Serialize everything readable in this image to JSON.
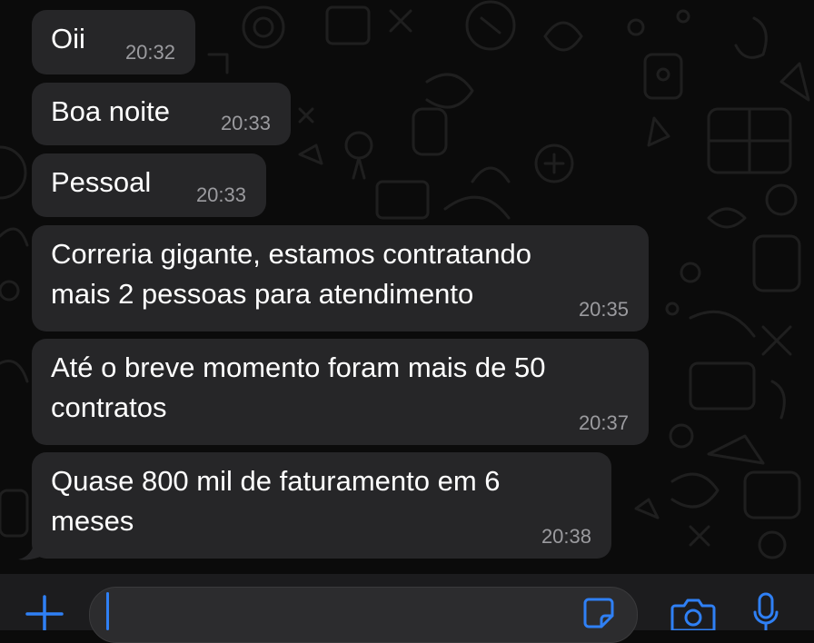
{
  "messages": [
    {
      "text": "Oii",
      "time": "20:32"
    },
    {
      "text": "Boa noite",
      "time": "20:33"
    },
    {
      "text": "Pessoal",
      "time": "20:33"
    },
    {
      "text": "Correria gigante, estamos contratando\nmais 2 pessoas para atendimento",
      "time": "20:35"
    },
    {
      "text": "Até o breve momento foram mais de 50\ncontratos",
      "time": "20:37"
    },
    {
      "text": "Quase 800 mil de faturamento em 6\nmeses",
      "time": "20:38"
    }
  ],
  "composer": {
    "value": ""
  },
  "icons": {
    "attach": "plus-icon",
    "sticker": "sticker-icon",
    "camera": "camera-icon",
    "microphone": "microphone-icon"
  },
  "colors": {
    "background": "#0b0b0b",
    "bubble": "#262628",
    "text": "#ffffff",
    "timestamp": "#9b9b9f",
    "accent": "#2f80f5",
    "composer_bar": "#1c1c1e"
  }
}
